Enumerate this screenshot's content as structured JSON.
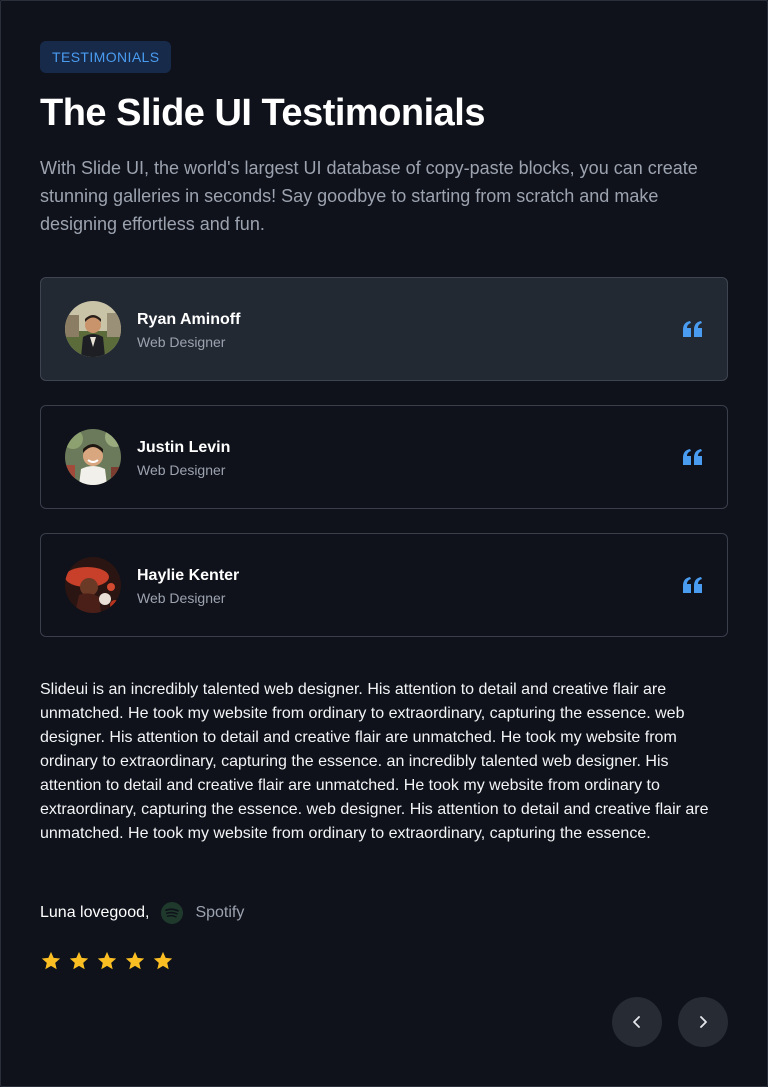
{
  "badge": "TESTIMONIALS",
  "title": "The Slide UI Testimonials",
  "subtitle": "With Slide UI, the world's largest UI database of copy-paste blocks, you can create stunning galleries in seconds! Say goodbye to starting from scratch and make designing effortless and fun.",
  "testimonials": [
    {
      "name": "Ryan Aminoff",
      "role": "Web Designer"
    },
    {
      "name": "Justin Levin",
      "role": "Web Designer"
    },
    {
      "name": "Haylie Kenter",
      "role": "Web Designer"
    }
  ],
  "active_index": 0,
  "review": {
    "text": "Slideui is an incredibly talented web designer. His attention to detail and creative flair are unmatched. He took my website from ordinary to extraordinary, capturing the essence. web designer. His attention to detail and creative flair are unmatched. He took my website from ordinary to extraordinary, capturing the essence. an incredibly talented web designer. His attention to detail and creative flair are unmatched. He took my website from ordinary to extraordinary, capturing the essence. web designer. His attention to detail and creative flair are unmatched. He took my website from ordinary to extraordinary, capturing the essence.",
    "author": "Luna lovegood,",
    "company": "Spotify",
    "rating": 5
  },
  "icons": {
    "quote": "quote-icon",
    "company_logo": "spotify-icon",
    "star": "star-icon",
    "prev": "chevron-left-icon",
    "next": "chevron-right-icon"
  },
  "colors": {
    "accent": "#4a9cf0",
    "star": "#fbbf24",
    "background": "#0f121b"
  }
}
